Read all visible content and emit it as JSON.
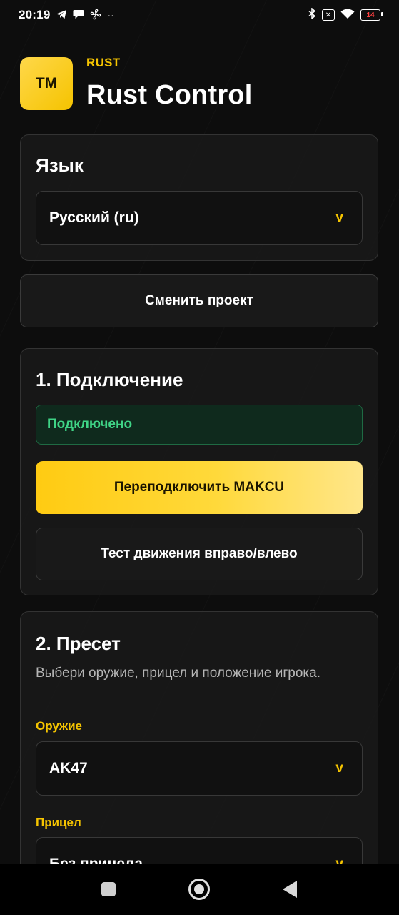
{
  "status_bar": {
    "time": "20:19",
    "more_indicator": "··",
    "battery_level": "14",
    "icons_left": [
      "telegram-icon",
      "chat-icon",
      "fan-icon"
    ],
    "icons_right": [
      "bluetooth-icon",
      "sim-icon",
      "wifi-icon",
      "battery-icon"
    ]
  },
  "header": {
    "logo_text": "TM",
    "kicker": "RUST",
    "title": "Rust Control"
  },
  "language_card": {
    "title": "Язык",
    "selected": "Русский (ru)",
    "chevron": "v"
  },
  "switch_project_button": "Сменить проект",
  "connection_card": {
    "title": "1. Подключение",
    "status": "Подключено",
    "reconnect_button": "Переподключить MAKCU",
    "test_button": "Тест движения вправо/влево"
  },
  "preset_card": {
    "title": "2. Пресет",
    "description": "Выбери оружие, прицел и положение игрока.",
    "weapon_label": "Оружие",
    "weapon_value": "AK47",
    "sight_label": "Прицел",
    "sight_value": "Без прицела",
    "chevron": "v"
  },
  "colors": {
    "accent": "#f5c400",
    "background": "#0d0d0d",
    "card": "#181818",
    "success_text": "#3fd486",
    "success_bg": "#0f2a1d"
  }
}
